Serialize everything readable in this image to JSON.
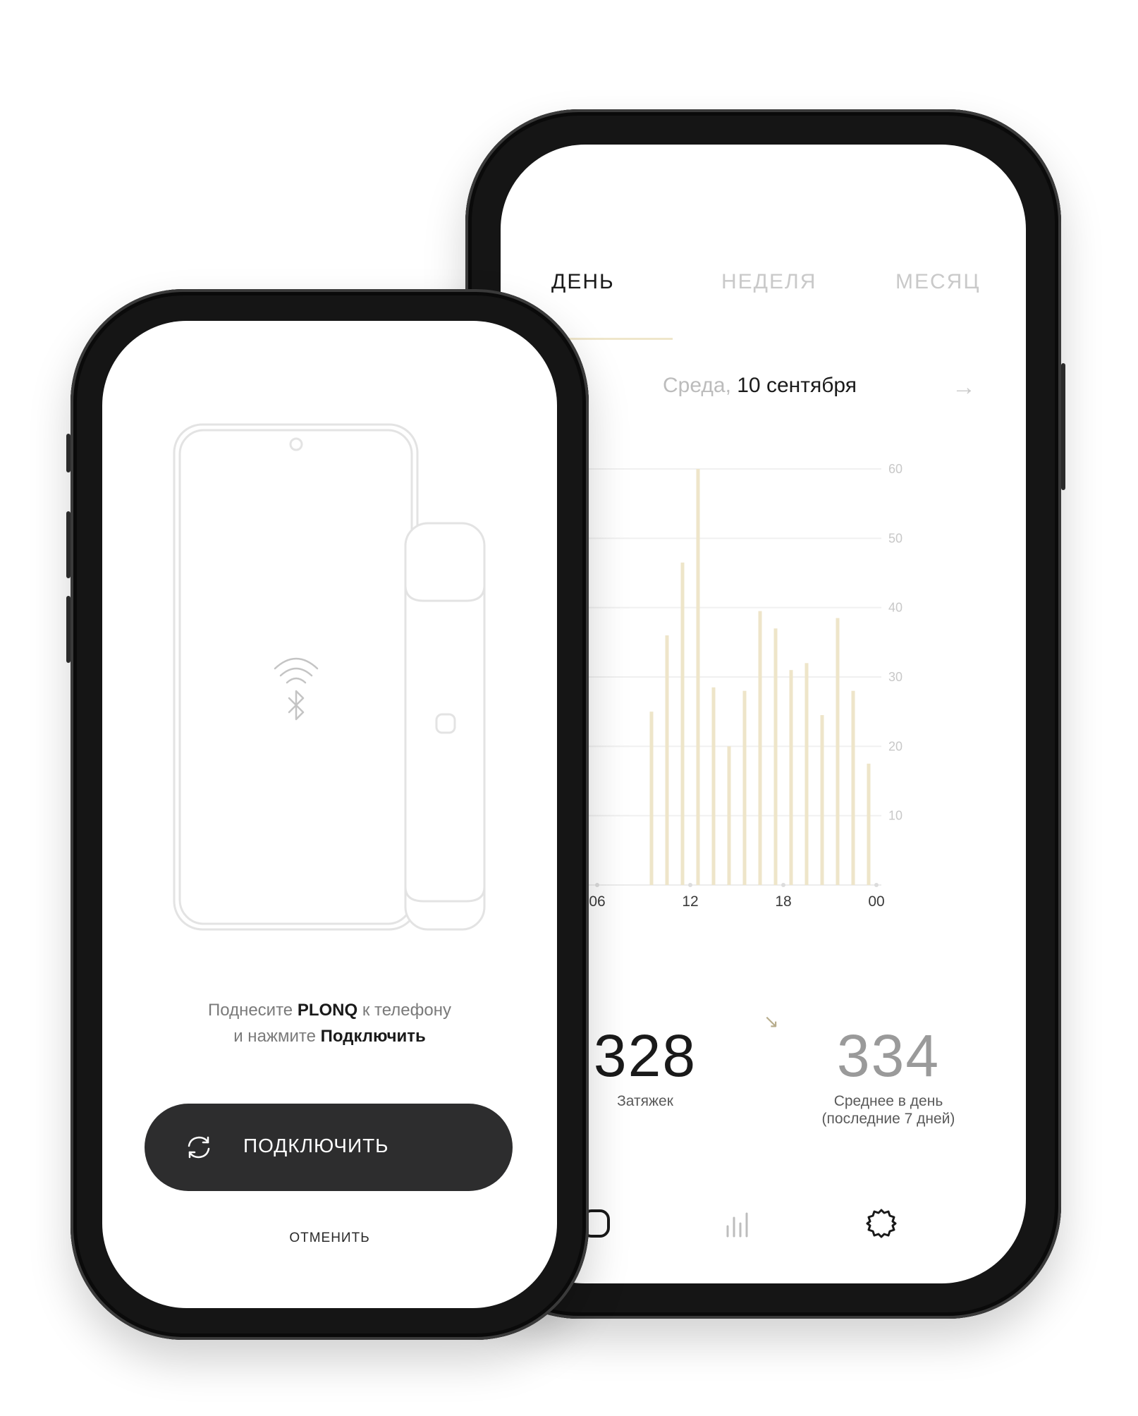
{
  "stats_screen": {
    "tabs": [
      {
        "label": "ДЕНЬ",
        "active": true
      },
      {
        "label": "НЕДЕЛЯ",
        "active": false
      },
      {
        "label": "МЕСЯЦ",
        "active": false
      }
    ],
    "date": {
      "weekday": "Среда,",
      "date": "10 сентября"
    },
    "next_arrow": "→",
    "trend_icon": "↘",
    "puffs": {
      "value": "328",
      "label": "Затяжек"
    },
    "average": {
      "value": "334",
      "label_line1": "Среднее в день",
      "label_line2": "(последние 7 дней)"
    },
    "nav": [
      "home-icon",
      "stats-icon",
      "settings-icon"
    ]
  },
  "connect_screen": {
    "instruction_line1": {
      "before": "Поднесите ",
      "bold": "PLONQ",
      "after": " к телефону"
    },
    "instruction_line2": {
      "before": "и нажмите ",
      "bold": "Подключить"
    },
    "connect_label": "ПОДКЛЮЧИТЬ",
    "cancel_label": "ОТМЕНИТЬ",
    "icons": [
      "wifi-icon",
      "bluetooth-icon",
      "sync-icon"
    ]
  },
  "chart_data": {
    "type": "bar",
    "x_tick_labels": [
      "00",
      "06",
      "12",
      "18",
      "00"
    ],
    "x_ticks_hours": [
      0,
      6,
      12,
      18,
      24
    ],
    "y_tick_labels": [
      "10",
      "20",
      "30",
      "40",
      "50",
      "60"
    ],
    "ylim": [
      0,
      60
    ],
    "grid": true,
    "bar_color": "#eee5c9",
    "series": [
      {
        "x": [
          9.5,
          10.5,
          11.5,
          12.5,
          13.5,
          14.5,
          15.5,
          16.5,
          17.5,
          18.5,
          19.5,
          20.5,
          21.5,
          22.5,
          23.5
        ],
        "values": [
          25,
          36,
          46.5,
          60,
          28.5,
          20,
          28,
          39.5,
          37,
          31,
          32,
          24.5,
          38.5,
          28,
          17.5
        ]
      }
    ],
    "empty_marker_hours": [
      6,
      12,
      18,
      24
    ]
  },
  "colors": {
    "accent": "#eee5c9",
    "button": "#2d2d2e",
    "text": "#1a1a1a"
  }
}
